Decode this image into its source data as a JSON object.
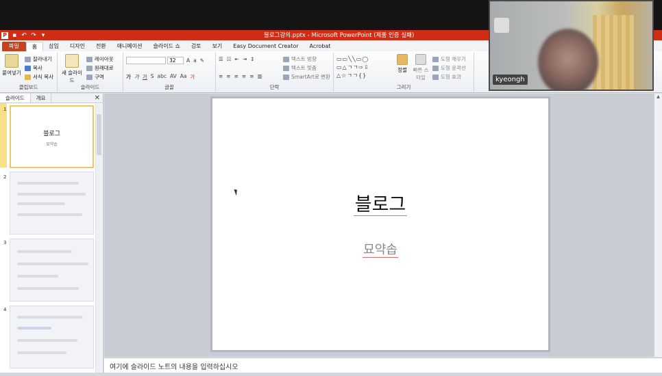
{
  "titlebar": {
    "title": "블로그강의.pptx - Microsoft PowerPoint (제품 인증 실패)"
  },
  "tabs": [
    "파일",
    "홈",
    "삽입",
    "디자인",
    "전환",
    "애니메이션",
    "슬라이드 쇼",
    "검토",
    "보기",
    "Easy Document Creator",
    "Acrobat"
  ],
  "ribbon": {
    "clipboard": {
      "paste": "붙여넣기",
      "cut": "잘라내기",
      "copy": "복사",
      "format_painter": "서식 복사",
      "label": "클립보드"
    },
    "slides": {
      "new_slide": "새 슬라이드",
      "layout": "레이아웃",
      "reset": "원래대로",
      "section": "구역",
      "label": "슬라이드"
    },
    "font": {
      "size": "32",
      "label": "글꼴"
    },
    "paragraph": {
      "text_direction": "텍스트 방향",
      "align_text": "텍스트 맞춤",
      "smartart": "SmartArt로 변환",
      "label": "단락"
    },
    "drawing": {
      "arrange": "정렬",
      "quick_styles": "빠른 스타일",
      "shape_fill": "도형 채우기",
      "shape_outline": "도형 윤곽선",
      "shape_effects": "도형 효과",
      "label": "그리기"
    }
  },
  "left_pane": {
    "tab_slides": "슬라이드",
    "tab_outline": "개요",
    "slide_numbers": [
      "1",
      "2",
      "3",
      "4"
    ],
    "thumb1_title": "블로그",
    "thumb1_sub": "묘약솝"
  },
  "slide": {
    "title": "블로그",
    "subtitle": "묘약솝"
  },
  "notes": {
    "placeholder": "여기에 슬라이드 노트의 내용을 입력하십시오"
  },
  "video": {
    "participant": "kyeongh"
  }
}
